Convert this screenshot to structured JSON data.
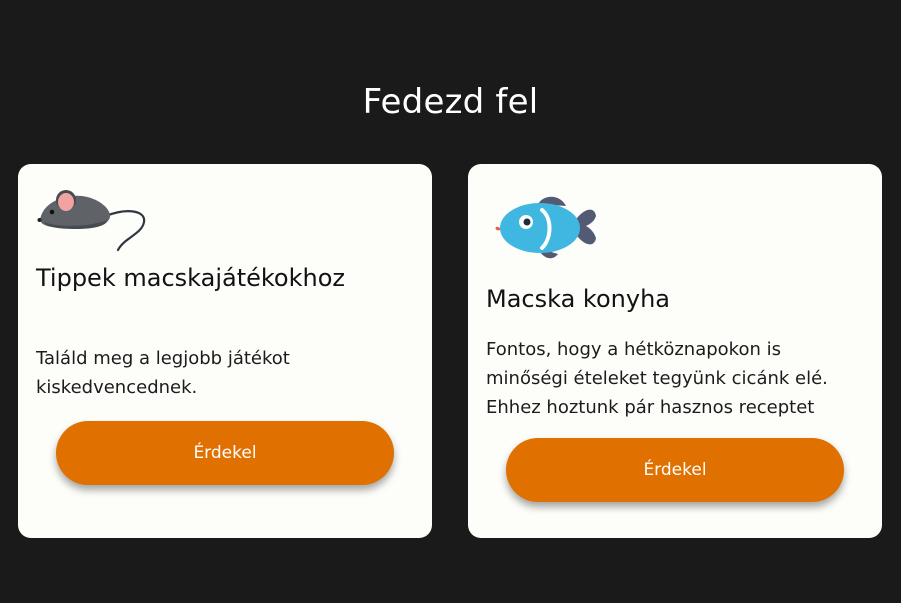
{
  "section": {
    "title": "Fedezd fel"
  },
  "cards": [
    {
      "icon": "mouse-toy-icon",
      "title": "Tippek macskajátékokhoz",
      "text": "Találd meg a legjobb játékot kiskedvencednek.",
      "button_label": "Érdekel"
    },
    {
      "icon": "fish-icon",
      "title": "Macska konyha",
      "text": "Fontos, hogy a hétköznapokon is minőségi ételeket tegyünk cicánk elé. Ehhez hoztunk pár hasznos receptet",
      "button_label": "Érdekel"
    }
  ],
  "colors": {
    "background": "#1a1a1a",
    "card": "#fdfdf9",
    "accent": "#e07000"
  }
}
